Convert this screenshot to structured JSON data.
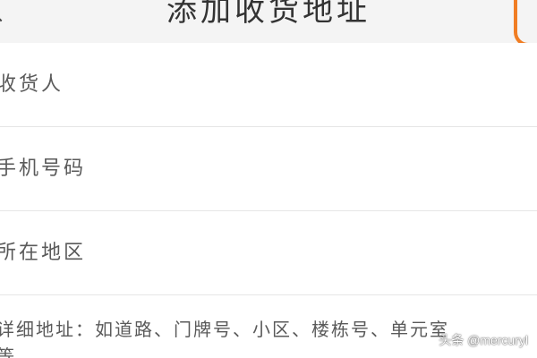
{
  "header": {
    "title": "添加收货地址"
  },
  "form": {
    "fields": [
      {
        "placeholder": "收货人"
      },
      {
        "placeholder": "手机号码"
      },
      {
        "placeholder": "所在地区"
      },
      {
        "placeholder": "详细地址：如道路、门牌号、小区、楼栋号、单元室",
        "wrap": "等"
      }
    ]
  },
  "watermark": "头条 @mercuryl",
  "colors": {
    "header_bg": "#f4f4f4",
    "annotation": "#f07d23",
    "divider": "#e6e6e6"
  },
  "icons": {
    "back": "chevron-left-icon"
  }
}
